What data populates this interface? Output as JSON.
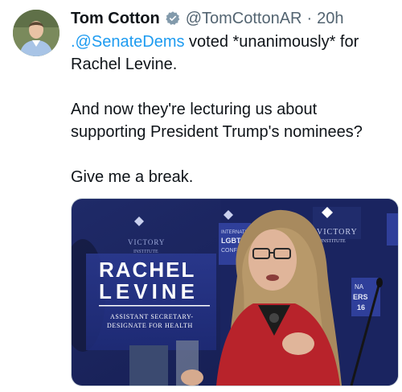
{
  "tweet": {
    "author_name": "Tom Cotton",
    "handle": "@TomCottonAR",
    "separator": "·",
    "time": "20h",
    "mention": ".@SenateDems",
    "line1_rest": " voted *unanimously* for",
    "line2": "Rachel Levine.",
    "para2_line1": "And now they're lecturing us about",
    "para2_line2": "supporting President Trump's nominees?",
    "para3": "Give me a break.",
    "verified_icon": "verified-badge-icon",
    "accent_color": "#1d9bf0",
    "secondary_text_color": "#536471"
  },
  "media": {
    "headline_line1": "RACHEL",
    "headline_line2": "LEVINE",
    "subtitle_line1": "ASSISTANT SECRETARY-",
    "subtitle_line2": "DESIGNATE FOR HEALTH",
    "backdrop_text_1": "VICTORY",
    "backdrop_text_2": "INSTITUTE",
    "backdrop_text_3": "VICTORY",
    "backdrop_text_4": "INSTITUTE",
    "backdrop_text_5": "INTERNATIONAL",
    "backdrop_text_6": "LGBT LE",
    "backdrop_text_7": "CONFER",
    "backdrop_text_8": "NA",
    "backdrop_text_9": "ERS",
    "backdrop_text_10": "16"
  }
}
